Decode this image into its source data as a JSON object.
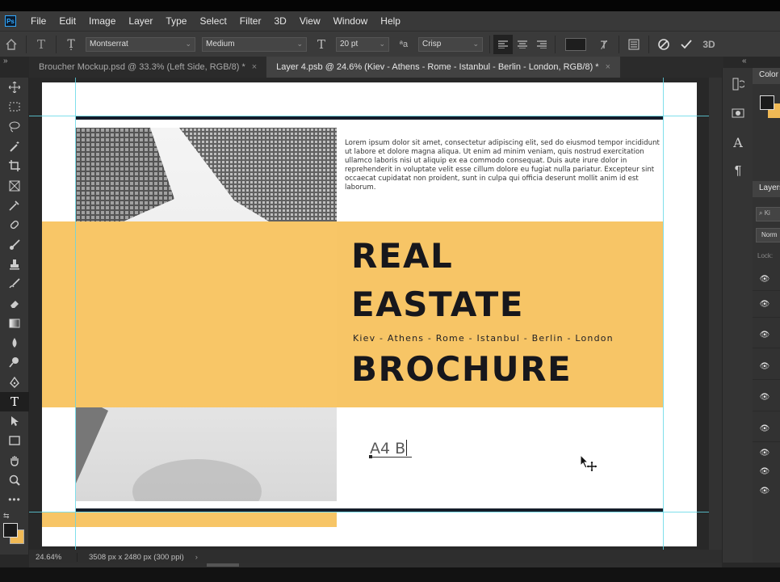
{
  "app": {
    "logo": "Ps"
  },
  "menu": [
    "File",
    "Edit",
    "Image",
    "Layer",
    "Type",
    "Select",
    "Filter",
    "3D",
    "View",
    "Window",
    "Help"
  ],
  "options": {
    "font_family": "Montserrat",
    "font_style": "Medium",
    "font_size": "20 pt",
    "antialias_label": "a",
    "antialias": "Crisp",
    "text_color": "#1e1e1e"
  },
  "tabs": [
    {
      "label": "Broucher Mockup.psd @ 33.3% (Left Side, RGB/8) *",
      "active": false,
      "close": "×"
    },
    {
      "label": "Layer 4.psb @ 24.6% (Kiev  -  Athens  -  Rome  -  Istanbul  -  Berlin  -  London, RGB/8) *",
      "active": true,
      "close": "×"
    }
  ],
  "collapse_left": "»",
  "collapse_right": "«",
  "tools": [
    "move-icon",
    "marquee-icon",
    "lasso-icon",
    "magic-wand-icon",
    "crop-icon",
    "frame-icon",
    "eyedropper-icon",
    "healing-brush-icon",
    "brush-icon",
    "clone-stamp-icon",
    "history-brush-icon",
    "eraser-icon",
    "gradient-icon",
    "blur-icon",
    "dodge-icon",
    "pen-icon",
    "type-icon",
    "path-selection-icon",
    "rectangle-icon",
    "hand-icon",
    "zoom-icon",
    "more-icon"
  ],
  "document": {
    "lorem": "Lorem ipsum dolor sit amet, consectetur adipiscing elit, sed do eiusmod tempor incididunt ut labore et dolore magna aliqua. Ut enim ad minim veniam, quis nostrud exercitation ullamco laboris nisi ut aliquip ex ea commodo consequat. Duis aute irure dolor in reprehenderit in voluptate velit esse cillum dolore eu fugiat nulla pariatur. Excepteur sint occaecat cupidatat non proident, sunt in culpa qui officia deserunt mollit anim id est laborum.",
    "title_line1": "REAL",
    "title_line2": "EASTATE",
    "cities": "Kiev  -  Athens  -  Rome  -  Istanbul  -  Berlin  -  London",
    "title_line3": "BROCHURE",
    "typing_text": "A4 B",
    "accent_color": "#f7c566",
    "dark_color": "#151d2a"
  },
  "status": {
    "zoom": "24.64%",
    "dims": "3508 px x 2480 px (300 ppi)",
    "arrow": "›"
  },
  "panels": {
    "color_tab": "Color",
    "layers_tab": "Layers",
    "layers_search": "Ki",
    "blend_mode": "Norm",
    "locks_label": "Lock:",
    "fg_color": "#1b1b1b",
    "bg_color": "#f0b955"
  }
}
